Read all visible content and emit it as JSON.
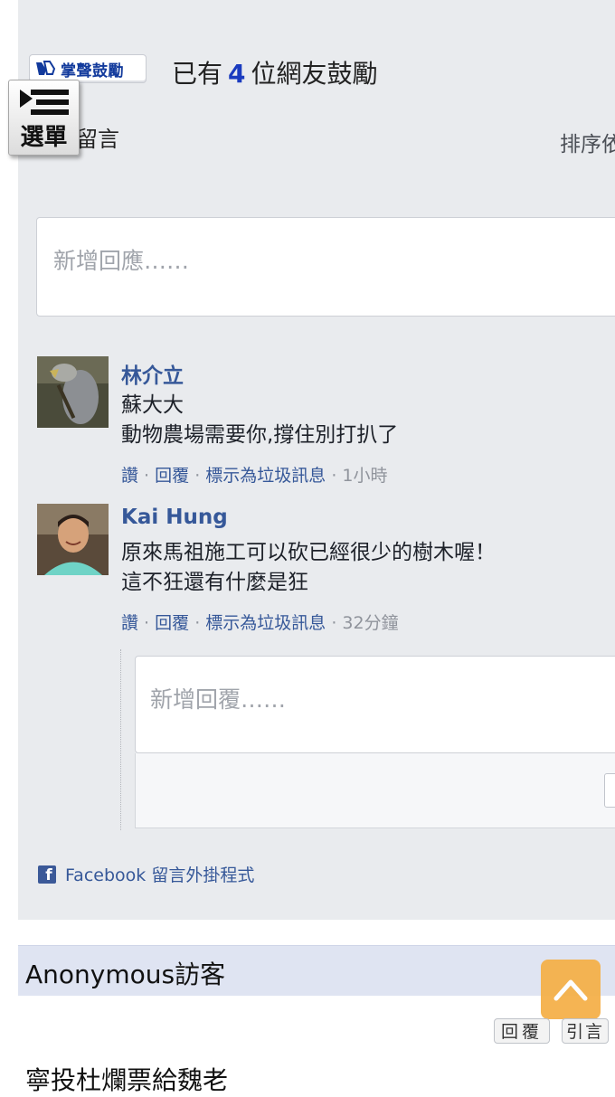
{
  "clap": {
    "badge_label": "掌聲鼓勵",
    "prefix": "已有",
    "count": "4",
    "suffix": "位網友鼓勵"
  },
  "menu": {
    "label": "選單"
  },
  "comments": {
    "heading": "留言",
    "sort_label": "排序依",
    "new_comment_placeholder": "新增回應……",
    "items": [
      {
        "author": "林介立",
        "lines": [
          "蘇大大",
          "動物農場需要你,撐住別打扒了"
        ],
        "like": "讚",
        "reply": "回覆",
        "spam": "標示為垃圾訊息",
        "time": "1小時"
      },
      {
        "author": "Kai Hung",
        "lines": [
          "原來馬祖施工可以砍已經很少的樹木喔！",
          "這不狂還有什麼是狂"
        ],
        "like": "讚",
        "reply": "回覆",
        "spam": "標示為垃圾訊息",
        "time": "32分鐘"
      }
    ],
    "reply_placeholder": "新增回覆……",
    "plugin_label": "Facebook 留言外掛程式"
  },
  "guest_post": {
    "name": "Anonymous訪客",
    "reply_button": "回覆",
    "quote_button": "引言",
    "message": "寧投杜爛票給魏老"
  },
  "colors": {
    "link": "#365899",
    "count": "#1a3bbf",
    "panel": "#e9ebee",
    "guest_bar": "#dfe4f2",
    "scroll_top_button": "#f5b14a"
  },
  "icons": {
    "menu": "hamburger-play-icon",
    "clap": "clapping-hands-icon",
    "facebook": "facebook-f-icon",
    "scroll_top": "chevron-up-icon"
  }
}
